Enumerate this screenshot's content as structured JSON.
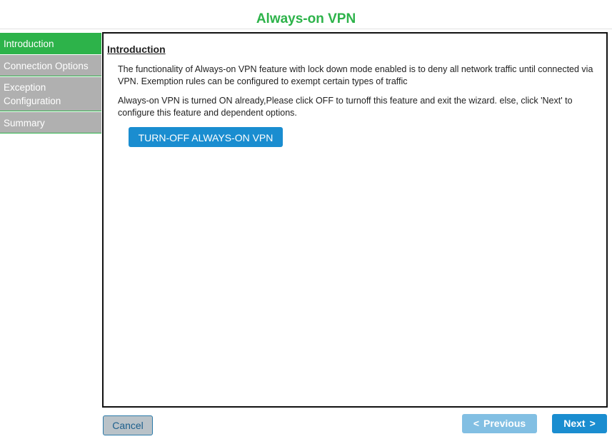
{
  "window": {
    "title": "Always-on VPN"
  },
  "sidebar": {
    "items": [
      {
        "label": "Introduction",
        "active": true
      },
      {
        "label": "Connection Options",
        "active": false
      },
      {
        "label": "Exception Configuration",
        "active": false
      },
      {
        "label": "Summary",
        "active": false
      }
    ]
  },
  "main": {
    "heading": "Introduction",
    "paragraph1": "The functionality of Always-on VPN feature with lock down mode enabled is to deny all network traffic until connected via VPN. Exemption rules can be configured to exempt certain types of traffic",
    "paragraph2": "Always-on VPN is turned ON already,Please click OFF to turnoff this feature and exit the wizard. else, click 'Next' to configure this feature and dependent options.",
    "turnoff_label": "TURN-OFF ALWAYS-ON VPN"
  },
  "footer": {
    "cancel_label": "Cancel",
    "previous_label": "Previous",
    "next_label": "Next",
    "previous_enabled": false
  },
  "colors": {
    "brand_green": "#2db34a",
    "button_blue": "#1a8dd0",
    "button_blue_disabled": "#82bfe3",
    "sidebar_inactive": "#b0b0b0"
  }
}
